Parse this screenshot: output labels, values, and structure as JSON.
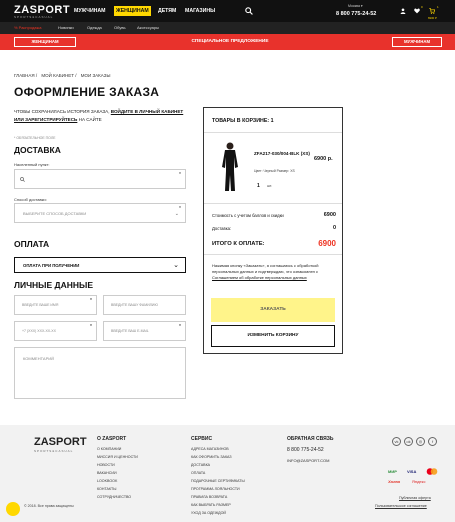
{
  "header": {
    "logo": "ZASPORT",
    "logo_sub": "SPORTS&CASUAL",
    "nav": [
      "МУЖЧИНАМ",
      "ЖЕНЩИНАМ",
      "ДЕТЯМ",
      "МАГАЗИНЫ"
    ],
    "active_nav": "ЖЕНЩИНАМ",
    "city": "Москва ▾",
    "phone": "8 800 775-24-52",
    "favorites_count": "0",
    "cart_count": "1",
    "cart_sum": "6900 Р"
  },
  "subnav": [
    "Распродажа",
    "Новинки",
    "Одежда",
    "Обувь",
    "Аксессуары"
  ],
  "promo": {
    "left_button": "ЖЕНЩИНАМ",
    "text": "СПЕЦИАЛЬНОЕ ПРЕДЛОЖЕНИЕ",
    "right_button": "МУЖЧИНАМ"
  },
  "breadcrumb": [
    "ГЛАВНАЯ /",
    "МОЙ КАБИНЕТ /",
    "МОИ ЗАКАЗЫ"
  ],
  "page_title": "ОФОРМЛЕНИЕ ЗАКАЗА",
  "note": {
    "before": "ЧТОБЫ СОХРАНИЛАСЬ ИСТОРИЯ ЗАКАЗА, ",
    "link": "ВОЙДИТЕ В ЛИЧНЫЙ КАБИНЕТ ИЛИ ЗАРЕГИСТРИРУЙТЕСЬ",
    "after": " НА САЙТЕ"
  },
  "required_note": "* ОБЯЗАТЕЛЬНОЕ ПОЛЕ",
  "delivery": {
    "heading": "ДОСТАВКА",
    "city_label": "Населенный пункт:",
    "method_label": "Способ доставки:",
    "method_placeholder": "ВЫБЕРИТЕ СПОСОБ ДОСТАВКИ"
  },
  "payment": {
    "heading": "ОПЛАТА",
    "selected": "ОПЛАТА ПРИ ПОЛУЧЕНИИ"
  },
  "personal": {
    "heading": "ЛИЧНЫЕ ДАННЫЕ",
    "name_placeholder": "ВВЕДИТЕ ВАШЕ ИМЯ",
    "surname_placeholder": "ВВЕДИТЕ ВАШУ ФАМИЛИЮ",
    "phone_placeholder": "+7 (XXX) XXX-XX-XX",
    "email_placeholder": "ВВЕДИТЕ ВАШ E-MAIL",
    "comment_placeholder": "КОММЕНТАРИЙ"
  },
  "cart": {
    "heading": "ТОВАРЫ В КОРЗИНЕ: 1",
    "product_name": "ZFA217-030/004-BLK (XS)",
    "product_price": "6900 р.",
    "product_meta": "Цвет: Черный   Размер: XS",
    "qty": "1",
    "qty_unit": "шт.",
    "discount_label": "Стоимость с учетом баллов и скидки",
    "discount_value": "6900",
    "delivery_label": "Доставка:",
    "delivery_value": "0",
    "total_label": "ИТОГО К ОПЛАТЕ:",
    "total_value": "6900",
    "agree_text": "Нажимая кнопку «Заказать», я соглашаюсь с обработкой персональных данных и подтверждаю, что ознакомлен с ",
    "agree_link": "Соглашением об обработке персональных данных",
    "order_button": "ЗАКАЗАТЬ",
    "edit_button": "ИЗМЕНИТЬ КОРЗИНУ"
  },
  "footer": {
    "logo": "ZASPORT",
    "logo_sub": "SPORTS&CASUAL",
    "about_heading": "О ZASPORT",
    "about_links": [
      "О КОМПАНИИ",
      "МИССИЯ И ЦЕННОСТИ",
      "НОВОСТИ",
      "ВАКАНСИИ",
      "LOOKBOOK",
      "КОНТАКТЫ",
      "СОТРУДНИЧЕСТВО"
    ],
    "service_heading": "СЕРВИС",
    "service_links": [
      "АДРЕСА МАГАЗИНОВ",
      "КАК ОФОРМИТЬ ЗАКАЗ",
      "ДОСТАВКА",
      "ОПЛАТА",
      "ПОДАРОЧНЫЕ СЕРТИФИКАТЫ",
      "ПРОГРАММА ЛОЯЛЬНОСТИ",
      "ПРАВИЛА ВОЗВРАТА",
      "КАК ВЫБРАТЬ РАЗМЕР",
      "УХОД ЗА ОДЕЖДОЙ"
    ],
    "contact_heading": "ОБРАТНАЯ СВЯЗЬ",
    "phone": "8 800 775-24-52",
    "email": "INFO@ZASPORT.COM",
    "social": [
      "vk",
      "ok",
      "ig",
      "fb"
    ],
    "payments": [
      "МИР",
      "VISA",
      "MC",
      "Халва",
      "Яндекс"
    ],
    "copyright": "© 2018. Все права защищены",
    "offer_link": "Публичная оферта",
    "agreement_link": "Пользовательское соглашение"
  }
}
